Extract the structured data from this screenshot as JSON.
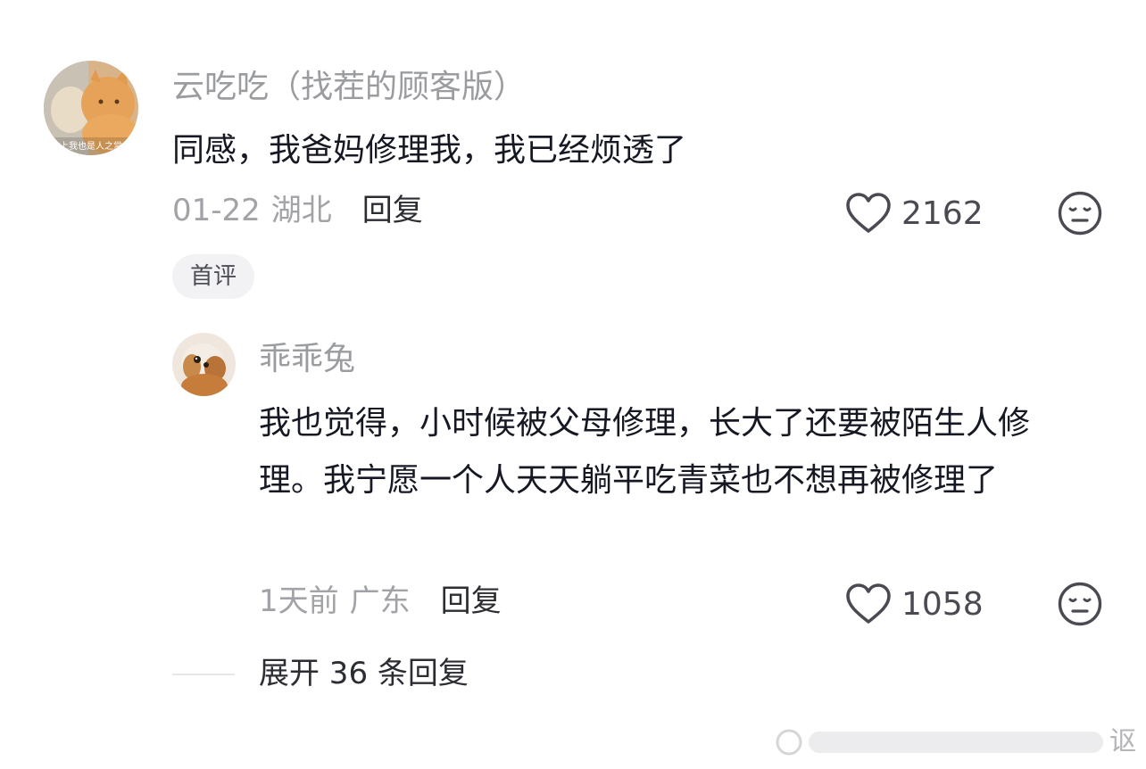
{
  "comment": {
    "username": "云吃吃（找茬的顾客版）",
    "text": "同感，我爸妈修理我，我已经烦透了",
    "time": "01-22",
    "region": "湖北",
    "reply_label": "回复",
    "likes": "2162",
    "badge": "首评",
    "avatar_caption": "上我也是人之常"
  },
  "reply": {
    "username": "乖乖兔",
    "text": "我也觉得，小时候被父母修理，长大了还要被陌生人修理。我宁愿一个人天天躺平吃青菜也不想再被修理了",
    "time": "1天前",
    "region": "广东",
    "reply_label": "回复",
    "likes": "1058"
  },
  "expand_label": "展开 36 条回复",
  "watermark_char": "讴",
  "icons": {
    "like": "heart-outline-icon",
    "dislike": "neutral-face-icon"
  },
  "colors": {
    "username": "#9a9ca0",
    "text": "#161823",
    "meta": "#a2a3a7",
    "badge_bg": "#f2f2f4"
  }
}
